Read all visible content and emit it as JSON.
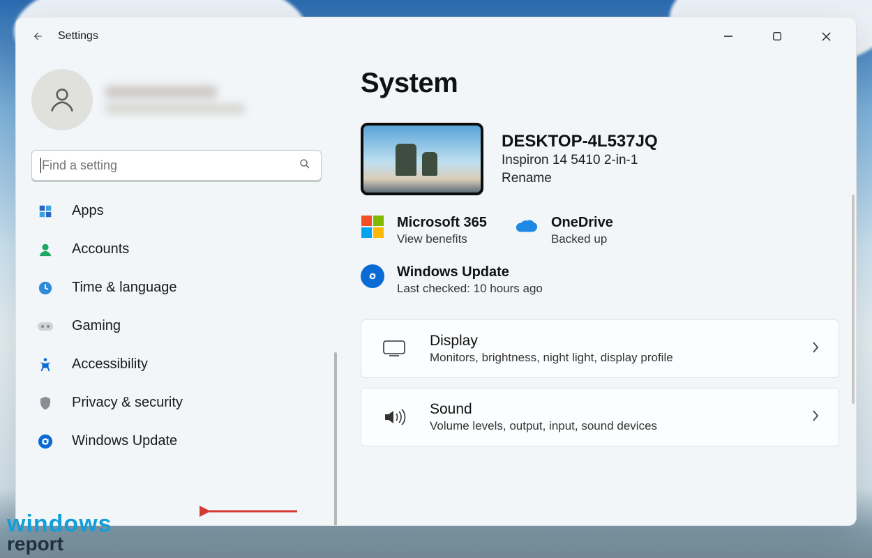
{
  "window": {
    "title": "Settings"
  },
  "search": {
    "placeholder": "Find a setting"
  },
  "sidebar": {
    "items": [
      {
        "label": "Apps",
        "icon": "apps-icon"
      },
      {
        "label": "Accounts",
        "icon": "accounts-icon"
      },
      {
        "label": "Time & language",
        "icon": "time-language-icon"
      },
      {
        "label": "Gaming",
        "icon": "gaming-icon"
      },
      {
        "label": "Accessibility",
        "icon": "accessibility-icon"
      },
      {
        "label": "Privacy & security",
        "icon": "privacy-icon"
      },
      {
        "label": "Windows Update",
        "icon": "windows-update-icon"
      }
    ]
  },
  "page": {
    "title": "System"
  },
  "device": {
    "name": "DESKTOP-4L537JQ",
    "model": "Inspiron 14 5410 2-in-1",
    "rename_label": "Rename"
  },
  "status": {
    "m365": {
      "title": "Microsoft 365",
      "sub": "View benefits"
    },
    "onedrive": {
      "title": "OneDrive",
      "sub": "Backed up"
    },
    "wu": {
      "title": "Windows Update",
      "sub": "Last checked: 10 hours ago"
    }
  },
  "cards": [
    {
      "title": "Display",
      "sub": "Monitors, brightness, night light, display profile"
    },
    {
      "title": "Sound",
      "sub": "Volume levels, output, input, sound devices"
    }
  ],
  "watermark": {
    "line1": "windows",
    "line2": "report"
  }
}
